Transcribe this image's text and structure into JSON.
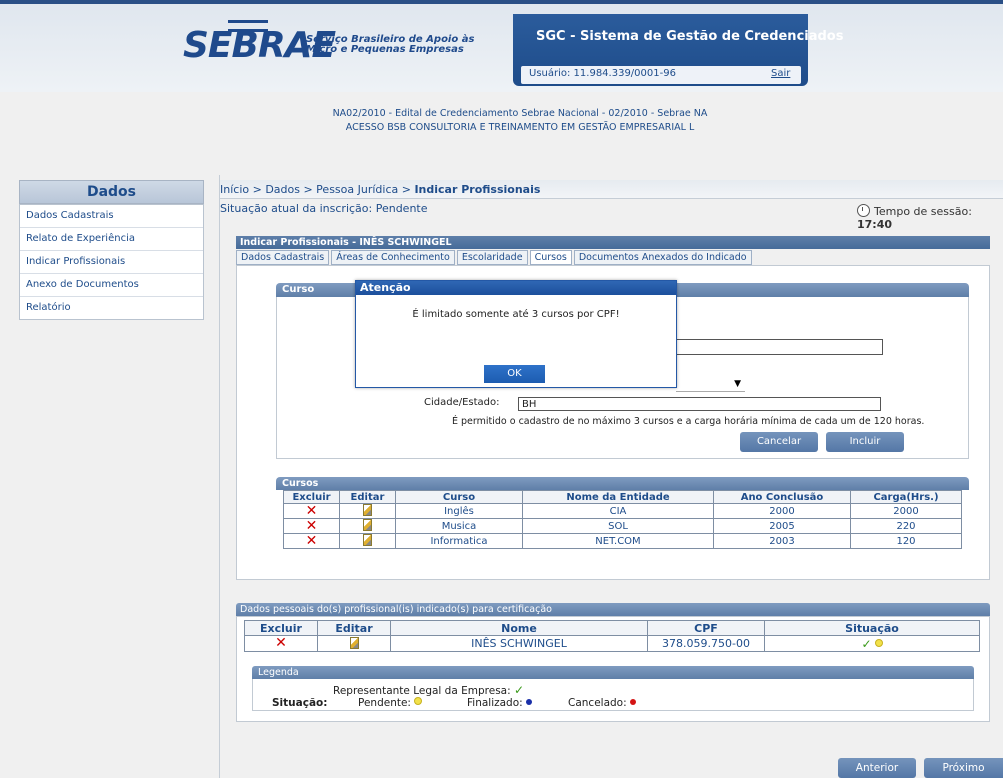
{
  "header": {
    "logo_text": "SEBRAE",
    "logo_tagline_1": "Serviço Brasileiro de Apoio às",
    "logo_tagline_2": "Micro e Pequenas Empresas",
    "system_title": "SGC - Sistema de Gestão de Credenciados",
    "user_label": "Usuário: 11.984.339/0001-96",
    "logout_label": "Sair",
    "notice_line_1": "NA02/2010 - Edital de Credenciamento Sebrae Nacional - 02/2010 - Sebrae NA",
    "notice_line_2": "ACESSO BSB CONSULTORIA E TREINAMENTO EM GESTÃO EMPRESARIAL L"
  },
  "sidebar": {
    "title": "Dados",
    "items": [
      {
        "label": "Dados Cadastrais"
      },
      {
        "label": "Relato de Experiência"
      },
      {
        "label": "Indicar Profissionais"
      },
      {
        "label": "Anexo de Documentos"
      },
      {
        "label": "Relatório"
      }
    ]
  },
  "breadcrumb": {
    "prefix": "Início > Dados > Pessoa Jurídica > ",
    "current": "Indicar Profissionais"
  },
  "status": "Situação atual da inscrição: Pendente",
  "session": {
    "label": "Tempo de sessão:",
    "time": "17:40"
  },
  "indicar": {
    "header": "Indicar Profissionais - INÊS SCHWINGEL",
    "tabs": [
      {
        "label": "Dados Cadastrais",
        "active": false
      },
      {
        "label": "Áreas de Conhecimento",
        "active": false
      },
      {
        "label": "Escolaridade",
        "active": false
      },
      {
        "label": "Cursos",
        "active": true
      },
      {
        "label": "Documentos Anexados do Indicado",
        "active": false
      }
    ]
  },
  "curso_form": {
    "section_title": "Curso",
    "city_label": "Cidade/Estado:",
    "city_value": "BH",
    "note": "É permitido o cadastro de no máximo 3 cursos e a carga horária mínima de cada um de 120 horas.",
    "cancel_label": "Cancelar",
    "include_label": "Incluir"
  },
  "cursos_table": {
    "title": "Cursos",
    "headers": [
      "Excluir",
      "Editar",
      "Curso",
      "Nome da Entidade",
      "Ano Conclusão",
      "Carga(Hrs.)"
    ],
    "rows": [
      {
        "curso": "Inglês",
        "entidade": "CIA",
        "ano": "2000",
        "carga": "2000"
      },
      {
        "curso": "Musica",
        "entidade": "SOL",
        "ano": "2005",
        "carga": "220"
      },
      {
        "curso": "Informatica",
        "entidade": "NET.COM",
        "ano": "2003",
        "carga": "120"
      }
    ]
  },
  "dados_pessoais": {
    "title": "Dados pessoais do(s) profissional(is) indicado(s) para certificação",
    "headers": [
      "Excluir",
      "Editar",
      "Nome",
      "CPF",
      "Situação"
    ],
    "rows": [
      {
        "nome": "INÊS SCHWINGEL",
        "cpf": "378.059.750-00"
      }
    ]
  },
  "legenda": {
    "title": "Legenda",
    "representante": "Representante Legal da Empresa:",
    "situacao_label": "Situação:",
    "pendente": "Pendente:",
    "finalizado": "Finalizado:",
    "cancelado": "Cancelado:",
    "colors": {
      "pendente": "#f2e14a",
      "finalizado": "#1a2fa8",
      "cancelado": "#d41414",
      "check": "#3a9a1a"
    }
  },
  "modal": {
    "title": "Atenção",
    "message": "É limitado somente até 3 cursos por CPF!",
    "ok_label": "OK"
  },
  "footer": {
    "prev_label": "Anterior",
    "next_label": "Próximo"
  }
}
